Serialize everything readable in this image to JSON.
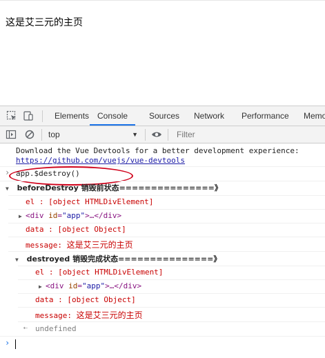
{
  "page": {
    "heading": "这是艾三元的主页"
  },
  "devtools": {
    "tabs": [
      "Elements",
      "Console",
      "Sources",
      "Network",
      "Performance",
      "Memo"
    ],
    "active_tab": "Console",
    "context": "top",
    "filter_placeholder": "Filter"
  },
  "console": {
    "vue_notice": "Download the Vue Devtools for a better development experience:",
    "vue_link": "https://github.com/vuejs/vue-devtools",
    "command": "app.$destroy()",
    "before_destroy": {
      "title": "beforeDestroy 销毁前状态===============》",
      "el_label": "el     : [object HTMLDivElement]",
      "div_open": "<div ",
      "div_attr": "id",
      "div_eq": "=",
      "div_val": "\"app\"",
      "div_close": ">…</div>",
      "data_label": "data   : [object Object]",
      "message_key": "message:",
      "message_val": "这是艾三元的主页"
    },
    "destroyed": {
      "title": "destroyed 销毁完成状态===============》",
      "el_label": "el     : [object HTMLDivElement]",
      "div_open": "<div ",
      "div_attr": "id",
      "div_eq": "=",
      "div_val": "\"app\"",
      "div_close": ">…</div>",
      "data_label": "data   : [object Object]",
      "message_key": "message:",
      "message_val": "这是艾三元的主页"
    },
    "return_value": "undefined"
  },
  "colors": {
    "accent": "#1a73e8",
    "log_red": "#c80000",
    "annotation_circle": "#d0021b"
  }
}
